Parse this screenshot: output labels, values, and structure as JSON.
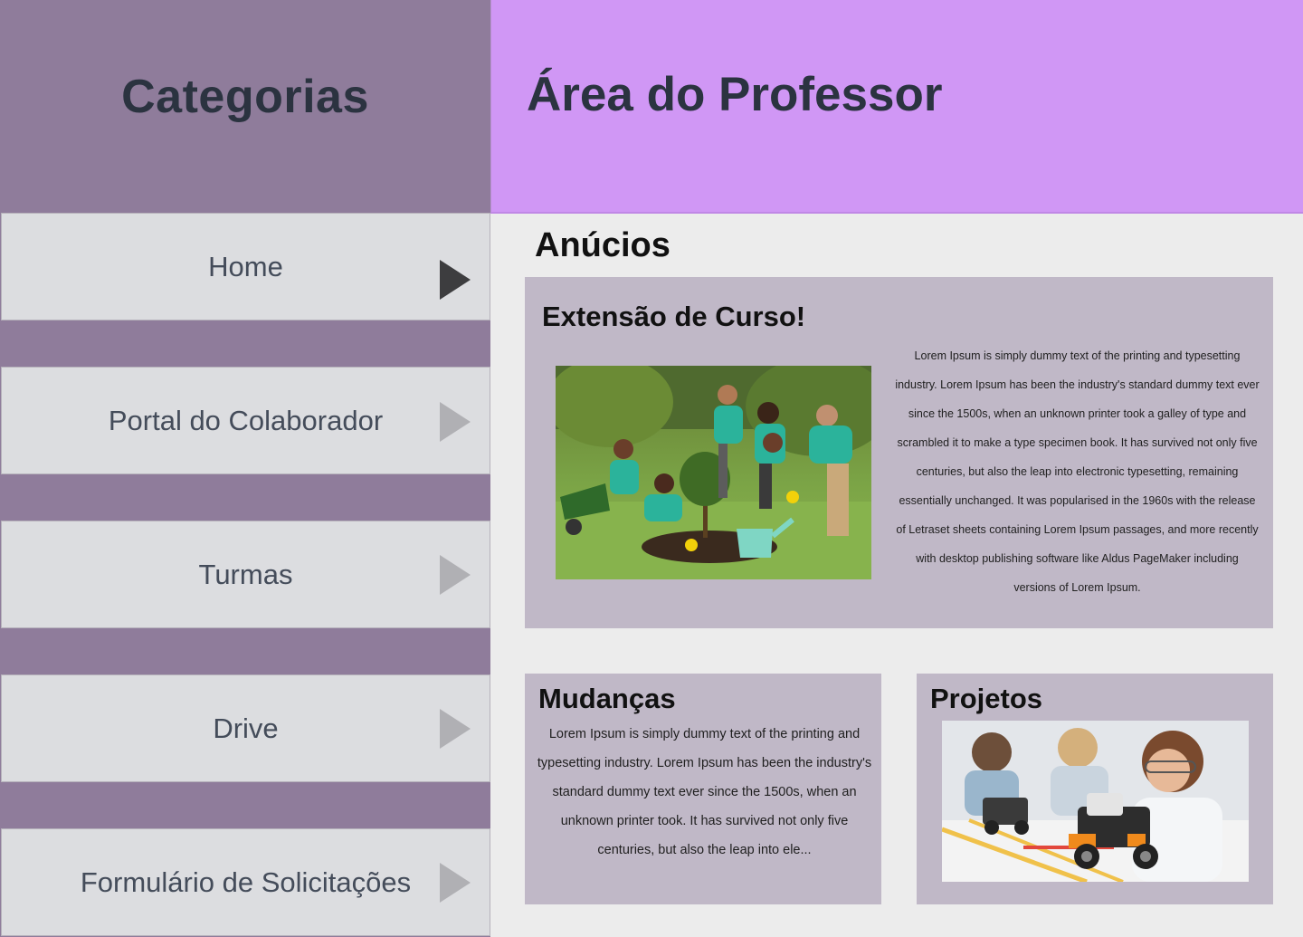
{
  "sidebar": {
    "title": "Categorias",
    "items": [
      {
        "label": "Home",
        "active": true
      },
      {
        "label": "Portal do Colaborador",
        "active": false
      },
      {
        "label": "Turmas",
        "active": false
      },
      {
        "label": "Drive",
        "active": false
      },
      {
        "label": "Formulário de Solicitações",
        "active": false
      }
    ]
  },
  "header": {
    "title": "Área do Professor"
  },
  "main": {
    "section_title": "Anúcios",
    "featured": {
      "title": "Extensão de Curso!",
      "image": "garden-volunteers-photo",
      "text": "Lorem Ipsum is simply dummy text of the printing and typesetting industry. Lorem Ipsum has been the industry's standard dummy text ever since the 1500s, when an unknown printer took a galley of type and scrambled it to make a type specimen book. It has survived not only five centuries, but also the leap into electronic typesetting, remaining essentially unchanged. It was popularised in the 1960s with the release of Letraset sheets containing Lorem Ipsum passages, and more recently with desktop publishing software like Aldus PageMaker including versions of Lorem Ipsum."
    },
    "changes": {
      "title": "Mudanças",
      "text": "Lorem Ipsum is simply dummy text of the printing and typesetting industry. Lorem Ipsum has been the industry's standard dummy text ever since the 1500s, when an unknown printer took. It has survived not only five centuries, but also the leap into ele..."
    },
    "projects": {
      "title": "Projetos",
      "image": "robotics-students-photo"
    }
  },
  "colors": {
    "sidebar_bg": "#8f7c9b",
    "header_bg": "#d097f5",
    "card_bg": "#c0b8c7",
    "nav_item_bg": "#dcdde0",
    "active_arrow": "#3d3d3f",
    "inactive_arrow": "#b0b0b4"
  }
}
